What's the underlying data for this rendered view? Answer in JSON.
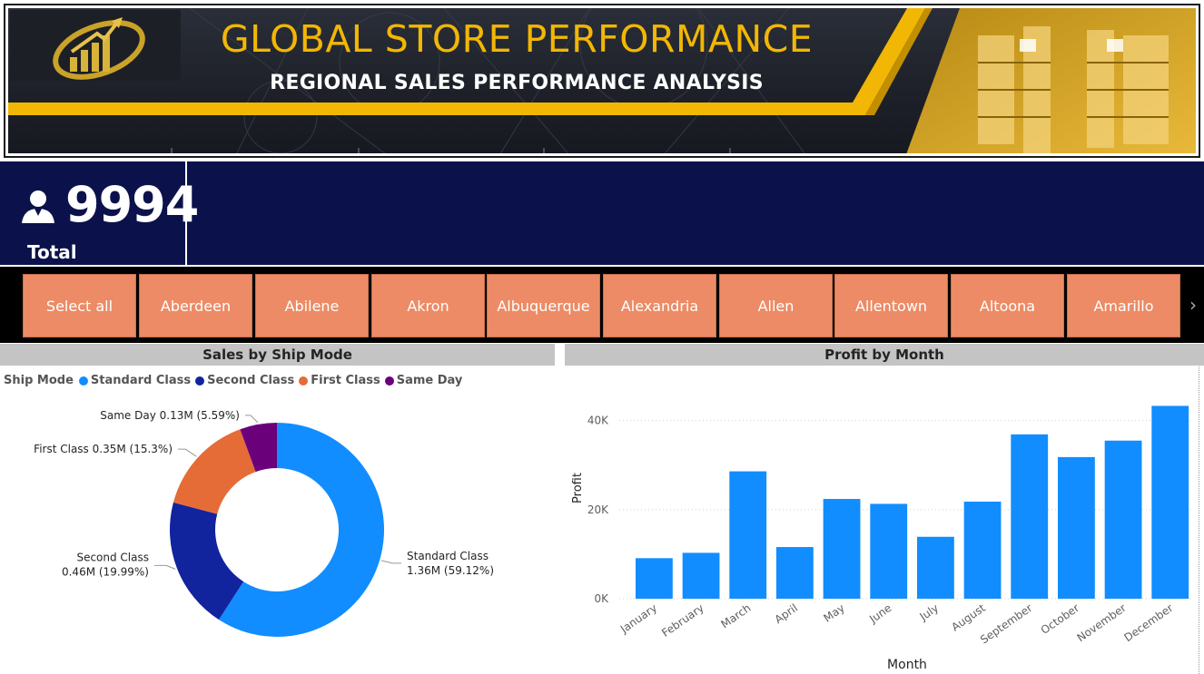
{
  "header": {
    "title": "GLOBAL STORE PERFORMANCE",
    "subtitle": "REGIONAL SALES PERFORMANCE ANALYSIS",
    "accent_color": "#f2b705"
  },
  "kpi": {
    "value": "9994",
    "label": "Total Customers",
    "icon": "user-icon"
  },
  "slicer": {
    "items": [
      "Select all",
      "Aberdeen",
      "Abilene",
      "Akron",
      "Albuquerque",
      "Alexandria",
      "Allen",
      "Allentown",
      "Altoona",
      "Amarillo"
    ],
    "color": "#ec8b65",
    "next_icon": "chevron-right-icon"
  },
  "donut": {
    "title": "Sales by Ship Mode",
    "legend_title": "Ship Mode"
  },
  "bar": {
    "title": "Profit by Month"
  },
  "chart_data": [
    {
      "type": "pie",
      "title": "Sales by Ship Mode",
      "legend_title": "Ship Mode",
      "legend_position": "top-left",
      "donut": true,
      "slices": [
        {
          "name": "Standard Class",
          "value": 1.36,
          "percent": 59.12,
          "label_line1": "Standard Class",
          "label_line2": "1.36M (59.12%)",
          "color": "#118dff"
        },
        {
          "name": "Second Class",
          "value": 0.46,
          "percent": 19.99,
          "label_line1": "Second Class",
          "label_line2": "0.46M (19.99%)",
          "color": "#12239e"
        },
        {
          "name": "First Class",
          "value": 0.35,
          "percent": 15.3,
          "label_line1": "First Class 0.35M (15.3%)",
          "label_line2": "",
          "color": "#e66c37"
        },
        {
          "name": "Same Day",
          "value": 0.13,
          "percent": 5.59,
          "label_line1": "Same Day 0.13M (5.59%)",
          "label_line2": "",
          "color": "#6b007b"
        }
      ]
    },
    {
      "type": "bar",
      "title": "Profit by Month",
      "xlabel": "Month",
      "ylabel": "Profit",
      "categories": [
        "January",
        "February",
        "March",
        "April",
        "May",
        "June",
        "July",
        "August",
        "September",
        "October",
        "November",
        "December"
      ],
      "values": [
        9100,
        10300,
        28600,
        11600,
        22400,
        21300,
        13900,
        21800,
        36900,
        31800,
        35500,
        43300
      ],
      "ylim": [
        0,
        44000
      ],
      "yticks": [
        0,
        20000,
        40000
      ],
      "ytick_labels": [
        "0K",
        "20K",
        "40K"
      ],
      "grid": true,
      "color": "#118dff"
    }
  ]
}
